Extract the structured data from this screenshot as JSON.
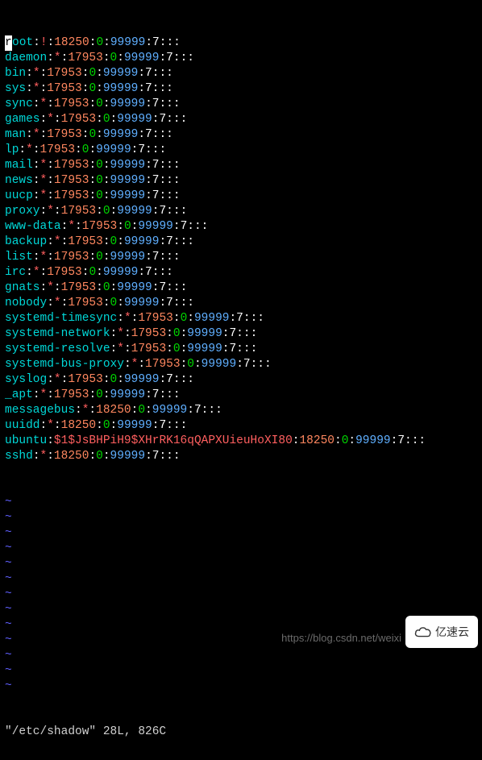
{
  "file_path": "/etc/shadow",
  "status_line": "\"/etc/shadow\" 28L, 826C",
  "watermark_url": "https://blog.csdn.net/weixi",
  "badge_text": "亿速云",
  "tilde_count": 13,
  "entries": [
    {
      "user": "root",
      "pw": "!",
      "lastchg": "18250",
      "minage": "0",
      "maxage": "99999",
      "rest": ":7:::"
    },
    {
      "user": "daemon",
      "pw": "*",
      "lastchg": "17953",
      "minage": "0",
      "maxage": "99999",
      "rest": ":7:::"
    },
    {
      "user": "bin",
      "pw": "*",
      "lastchg": "17953",
      "minage": "0",
      "maxage": "99999",
      "rest": ":7:::"
    },
    {
      "user": "sys",
      "pw": "*",
      "lastchg": "17953",
      "minage": "0",
      "maxage": "99999",
      "rest": ":7:::"
    },
    {
      "user": "sync",
      "pw": "*",
      "lastchg": "17953",
      "minage": "0",
      "maxage": "99999",
      "rest": ":7:::"
    },
    {
      "user": "games",
      "pw": "*",
      "lastchg": "17953",
      "minage": "0",
      "maxage": "99999",
      "rest": ":7:::"
    },
    {
      "user": "man",
      "pw": "*",
      "lastchg": "17953",
      "minage": "0",
      "maxage": "99999",
      "rest": ":7:::"
    },
    {
      "user": "lp",
      "pw": "*",
      "lastchg": "17953",
      "minage": "0",
      "maxage": "99999",
      "rest": ":7:::"
    },
    {
      "user": "mail",
      "pw": "*",
      "lastchg": "17953",
      "minage": "0",
      "maxage": "99999",
      "rest": ":7:::"
    },
    {
      "user": "news",
      "pw": "*",
      "lastchg": "17953",
      "minage": "0",
      "maxage": "99999",
      "rest": ":7:::"
    },
    {
      "user": "uucp",
      "pw": "*",
      "lastchg": "17953",
      "minage": "0",
      "maxage": "99999",
      "rest": ":7:::"
    },
    {
      "user": "proxy",
      "pw": "*",
      "lastchg": "17953",
      "minage": "0",
      "maxage": "99999",
      "rest": ":7:::"
    },
    {
      "user": "www-data",
      "pw": "*",
      "lastchg": "17953",
      "minage": "0",
      "maxage": "99999",
      "rest": ":7:::"
    },
    {
      "user": "backup",
      "pw": "*",
      "lastchg": "17953",
      "minage": "0",
      "maxage": "99999",
      "rest": ":7:::"
    },
    {
      "user": "list",
      "pw": "*",
      "lastchg": "17953",
      "minage": "0",
      "maxage": "99999",
      "rest": ":7:::"
    },
    {
      "user": "irc",
      "pw": "*",
      "lastchg": "17953",
      "minage": "0",
      "maxage": "99999",
      "rest": ":7:::"
    },
    {
      "user": "gnats",
      "pw": "*",
      "lastchg": "17953",
      "minage": "0",
      "maxage": "99999",
      "rest": ":7:::"
    },
    {
      "user": "nobody",
      "pw": "*",
      "lastchg": "17953",
      "minage": "0",
      "maxage": "99999",
      "rest": ":7:::"
    },
    {
      "user": "systemd-timesync",
      "pw": "*",
      "lastchg": "17953",
      "minage": "0",
      "maxage": "99999",
      "rest": ":7:::"
    },
    {
      "user": "systemd-network",
      "pw": "*",
      "lastchg": "17953",
      "minage": "0",
      "maxage": "99999",
      "rest": ":7:::"
    },
    {
      "user": "systemd-resolve",
      "pw": "*",
      "lastchg": "17953",
      "minage": "0",
      "maxage": "99999",
      "rest": ":7:::"
    },
    {
      "user": "systemd-bus-proxy",
      "pw": "*",
      "lastchg": "17953",
      "minage": "0",
      "maxage": "99999",
      "rest": ":7:::"
    },
    {
      "user": "syslog",
      "pw": "*",
      "lastchg": "17953",
      "minage": "0",
      "maxage": "99999",
      "rest": ":7:::"
    },
    {
      "user": "_apt",
      "pw": "*",
      "lastchg": "17953",
      "minage": "0",
      "maxage": "99999",
      "rest": ":7:::"
    },
    {
      "user": "messagebus",
      "pw": "*",
      "lastchg": "18250",
      "minage": "0",
      "maxage": "99999",
      "rest": ":7:::"
    },
    {
      "user": "uuidd",
      "pw": "*",
      "lastchg": "18250",
      "minage": "0",
      "maxage": "99999",
      "rest": ":7:::"
    },
    {
      "user": "ubuntu",
      "pw": "$1$JsBHPiH9$XHrRK16qQAPXUieuHoXI80",
      "lastchg": "18250",
      "minage": "0",
      "maxage": "99999",
      "rest": ":7:::"
    },
    {
      "user": "sshd",
      "pw": "*",
      "lastchg": "18250",
      "minage": "0",
      "maxage": "99999",
      "rest": ":7:::"
    }
  ]
}
